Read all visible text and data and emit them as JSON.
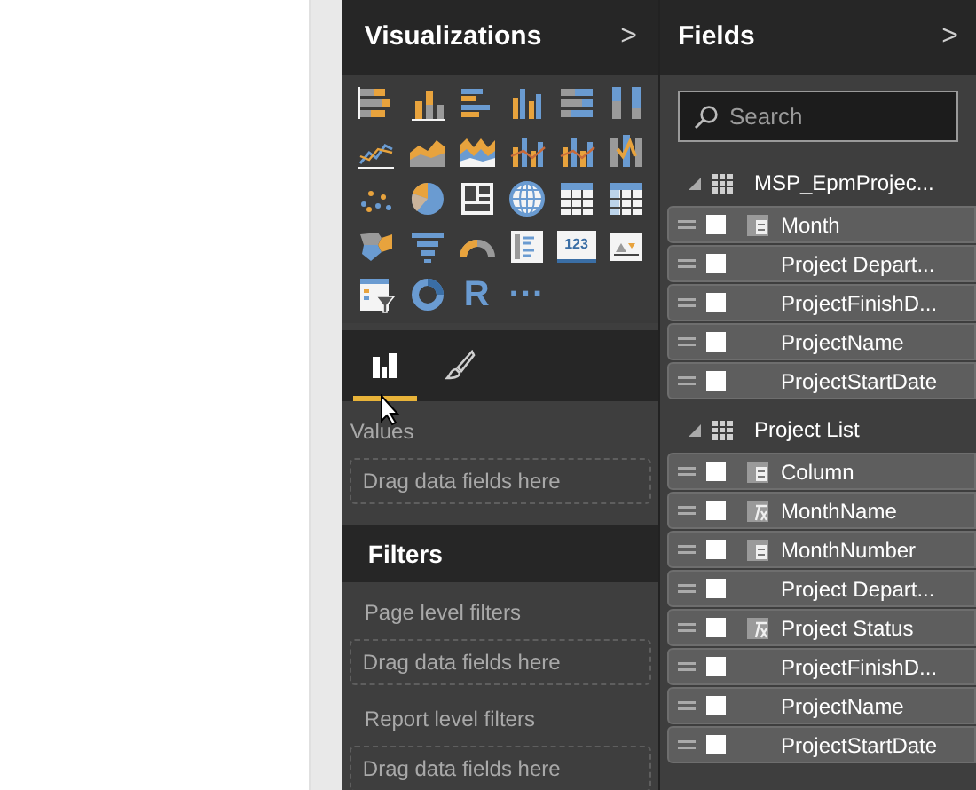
{
  "visualizations": {
    "title": "Visualizations",
    "collapse_glyph": ">",
    "icons": [
      {
        "kind": "stacked-bar"
      },
      {
        "kind": "stacked-column"
      },
      {
        "kind": "clustered-bar"
      },
      {
        "kind": "clustered-column"
      },
      {
        "kind": "bar-100"
      },
      {
        "kind": "column-100"
      },
      {
        "kind": "line"
      },
      {
        "kind": "area"
      },
      {
        "kind": "stacked-area"
      },
      {
        "kind": "line-column"
      },
      {
        "kind": "line-column"
      },
      {
        "kind": "ribbon"
      },
      {
        "kind": "scatter"
      },
      {
        "kind": "pie"
      },
      {
        "kind": "treemap"
      },
      {
        "kind": "globe"
      },
      {
        "kind": "table"
      },
      {
        "kind": "matrix"
      },
      {
        "kind": "filled-map"
      },
      {
        "kind": "funnel"
      },
      {
        "kind": "gauge"
      },
      {
        "kind": "multi-card"
      },
      {
        "kind": "card",
        "glyph": "123"
      },
      {
        "kind": "kpi"
      },
      {
        "kind": "slicer"
      },
      {
        "kind": "donut"
      },
      {
        "kind": "letter",
        "glyph": "R"
      },
      {
        "kind": "letter",
        "glyph": "···"
      }
    ],
    "tabs": [
      {
        "kind": "fields",
        "selected": true
      },
      {
        "kind": "format",
        "selected": false
      }
    ],
    "wells": [
      {
        "label": "Values",
        "placeholder": "Drag data fields here"
      }
    ]
  },
  "filters": {
    "title": "Filters",
    "sections": [
      {
        "label": "Page level filters",
        "placeholder": "Drag data fields here"
      },
      {
        "label": "Report level filters",
        "placeholder": "Drag data fields here"
      }
    ]
  },
  "fields": {
    "title": "Fields",
    "collapse_glyph": ">",
    "search": {
      "placeholder": "Search"
    },
    "tables": [
      {
        "name": "MSP_EpmProjec...",
        "expanded": true,
        "fields": [
          {
            "name": "Month",
            "kind": "column",
            "checked": false
          },
          {
            "name": "Project Depart...",
            "kind": "plain",
            "checked": false
          },
          {
            "name": "ProjectFinishD...",
            "kind": "plain",
            "checked": false
          },
          {
            "name": "ProjectName",
            "kind": "plain",
            "checked": false
          },
          {
            "name": "ProjectStartDate",
            "kind": "plain",
            "checked": false
          }
        ]
      },
      {
        "name": "Project List",
        "expanded": true,
        "fields": [
          {
            "name": "Column",
            "kind": "column",
            "checked": false
          },
          {
            "name": "MonthName",
            "kind": "calc",
            "checked": false
          },
          {
            "name": "MonthNumber",
            "kind": "column",
            "checked": false
          },
          {
            "name": "Project Depart...",
            "kind": "plain",
            "checked": false
          },
          {
            "name": "Project Status",
            "kind": "calc",
            "checked": false
          },
          {
            "name": "ProjectFinishD...",
            "kind": "plain",
            "checked": false
          },
          {
            "name": "ProjectName",
            "kind": "plain",
            "checked": false
          },
          {
            "name": "ProjectStartDate",
            "kind": "plain",
            "checked": false
          }
        ]
      }
    ]
  }
}
